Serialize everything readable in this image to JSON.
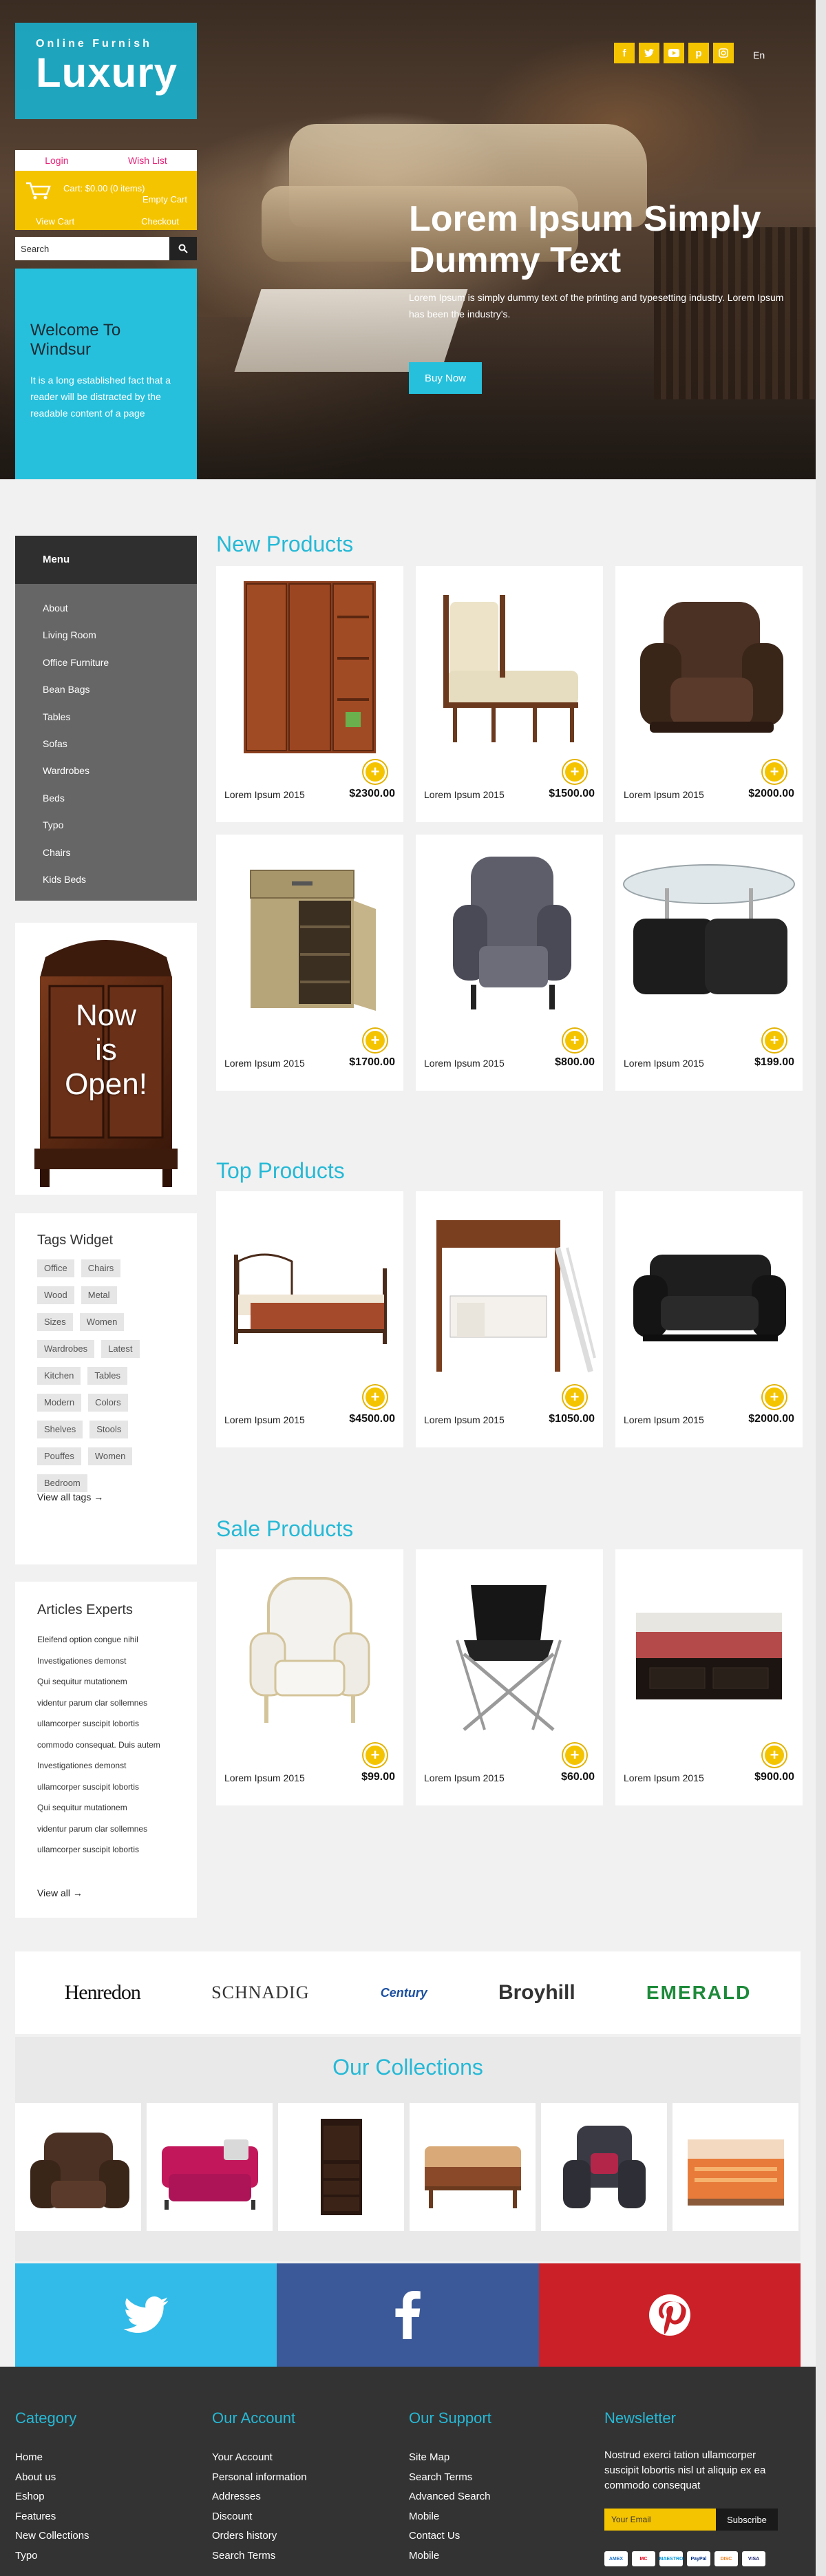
{
  "header": {
    "brand_subtitle": "Online Furnish",
    "brand_title": "Luxury",
    "login": "Login",
    "wishlist": "Wish List",
    "cart_summary": "Cart: $0.00 (0 items)",
    "cart_empty": "Empty Cart",
    "view_cart": "View Cart",
    "checkout": "Checkout",
    "search_placeholder": "Search",
    "language": "En",
    "social_icons": [
      "facebook-icon",
      "twitter-icon",
      "youtube-icon",
      "pinterest-icon",
      "instagram-icon"
    ],
    "welcome_title": "Welcome To Windsur",
    "welcome_text": "It is a long established fact that a reader will be distracted by the readable content of a page"
  },
  "hero": {
    "title": "Lorem Ipsum Simply Dummy Text",
    "text": "Lorem Ipsum is simply dummy text of the printing and typesetting industry. Lorem Ipsum has been the industry's.",
    "button": "Buy Now"
  },
  "sidebar": {
    "menu_title": "Menu",
    "menu_items": [
      "About",
      "Living Room",
      "Office Furniture",
      "Bean Bags",
      "Tables",
      "Sofas",
      "Wardrobes",
      "Beds",
      "Typo",
      "Chairs",
      "Kids Beds"
    ],
    "promo_text": [
      "Now",
      "is",
      "Open!"
    ],
    "tags_title": "Tags Widget",
    "tags": [
      [
        "Office",
        "Chairs"
      ],
      [
        "Wood",
        "Metal"
      ],
      [
        "Sizes",
        "Women"
      ],
      [
        "Wardrobes",
        "Latest"
      ],
      [
        "Kitchen",
        "Tables"
      ],
      [
        "Modern",
        "Colors"
      ],
      [
        "Shelves",
        "Stools"
      ],
      [
        "Pouffes",
        "Women"
      ],
      [
        "Bedroom"
      ]
    ],
    "tags_view_all": "View all tags →",
    "articles_title": "Articles Experts",
    "articles": [
      "Eleifend option congue nihil",
      "Investigationes demonst",
      "Qui sequitur mutationem",
      "videntur parum clar sollemnes",
      "ullamcorper suscipit lobortis",
      "commodo consequat. Duis autem",
      "Investigationes demonst",
      "ullamcorper suscipit lobortis",
      "Qui sequitur mutationem",
      "videntur parum clar sollemnes",
      "ullamcorper suscipit lobortis"
    ],
    "articles_view_all": "View all →"
  },
  "sections": {
    "new_title": "New Products",
    "top_title": "Top Products",
    "sale_title": "Sale Products"
  },
  "new_products": [
    {
      "name": "Lorem Ipsum 2015",
      "price": "$2300.00",
      "image": "wardrobe"
    },
    {
      "name": "Lorem Ipsum 2015",
      "price": "$1500.00",
      "image": "chaise-chair"
    },
    {
      "name": "Lorem Ipsum 2015",
      "price": "$2000.00",
      "image": "recliner"
    },
    {
      "name": "Lorem Ipsum 2015",
      "price": "$1700.00",
      "image": "shoe-cabinet"
    },
    {
      "name": "Lorem Ipsum 2015",
      "price": "$800.00",
      "image": "wingback-chair"
    },
    {
      "name": "Lorem Ipsum 2015",
      "price": "$199.00",
      "image": "glass-table"
    }
  ],
  "top_products": [
    {
      "name": "Lorem Ipsum 2015",
      "price": "$4500.00",
      "image": "metal-bed"
    },
    {
      "name": "Lorem Ipsum 2015",
      "price": "$1050.00",
      "image": "loft-bed"
    },
    {
      "name": "Lorem Ipsum 2015",
      "price": "$2000.00",
      "image": "leather-sofa"
    }
  ],
  "sale_products": [
    {
      "name": "Lorem Ipsum 2015",
      "price": "$99.00",
      "image": "armchair"
    },
    {
      "name": "Lorem Ipsum 2015",
      "price": "$60.00",
      "image": "camp-chair"
    },
    {
      "name": "Lorem Ipsum 2015",
      "price": "$900.00",
      "image": "storage-bed"
    }
  ],
  "brands": [
    "Henredon",
    "SCHNADIG",
    "Century",
    "Broyhill",
    "EMERALD"
  ],
  "collections": {
    "title": "Our Collections"
  },
  "footer": {
    "category_title": "Category",
    "category_items": [
      "Home",
      "About us",
      "Eshop",
      "Features",
      "New Collections",
      "Typo"
    ],
    "account_title": "Our Account",
    "account_items": [
      "Your Account",
      "Personal information",
      "Addresses",
      "Discount",
      "Orders history",
      "Search Terms"
    ],
    "support_title": "Our Support",
    "support_items": [
      "Site Map",
      "Search Terms",
      "Advanced Search",
      "Mobile",
      "Contact Us",
      "Mobile"
    ],
    "newsletter_title": "Newsletter",
    "newsletter_text": "Nostrud exerci tation ullamcorper suscipit lobortis nisl ut aliquip ex ea commodo consequat",
    "email_placeholder": "Your Email",
    "subscribe": "Subscribe",
    "payments": [
      "AMEX",
      "MC",
      "MAESTRO",
      "PayPal",
      "DISC",
      "VISA"
    ]
  },
  "colors": {
    "accent": "#26b9d6",
    "yellow": "#f5c400",
    "pink": "#e8247a",
    "footer": "#333333"
  }
}
